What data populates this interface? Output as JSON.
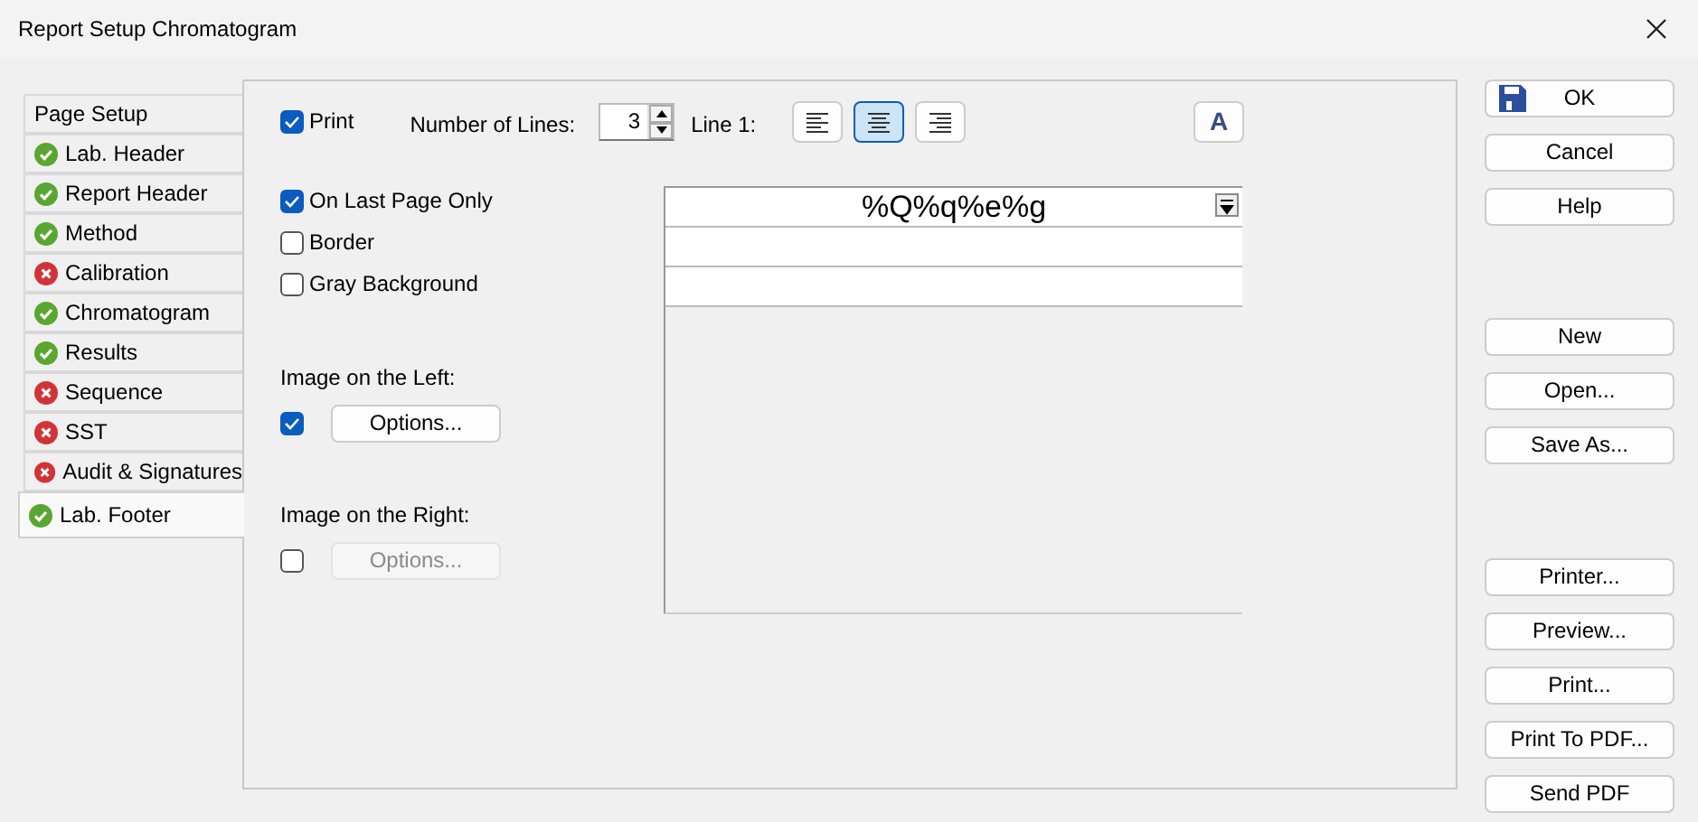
{
  "window": {
    "title": "Report Setup Chromatogram"
  },
  "tabs": [
    {
      "label": "Page Setup",
      "selected": false
    },
    {
      "label": "Lab. Header",
      "kind": "ok",
      "selected": false
    },
    {
      "label": "Report Header",
      "kind": "ok",
      "selected": false
    },
    {
      "label": "Method",
      "kind": "ok",
      "selected": false
    },
    {
      "label": "Calibration",
      "kind": "error",
      "selected": false
    },
    {
      "label": "Chromatogram",
      "kind": "ok",
      "selected": false
    },
    {
      "label": "Results",
      "kind": "ok",
      "selected": false
    },
    {
      "label": "Sequence",
      "kind": "error",
      "selected": false
    },
    {
      "label": "SST",
      "kind": "error",
      "selected": false
    },
    {
      "label": "Audit & Signatures",
      "kind": "error",
      "selected": false
    },
    {
      "label": "Lab. Footer",
      "kind": "ok",
      "selected": true
    }
  ],
  "print": {
    "label": "Print",
    "checked": true
  },
  "number_of_lines": {
    "label": "Number of Lines:",
    "value": "3"
  },
  "line_label": "Line 1:",
  "alignment_buttons": [
    {
      "kind": "left",
      "selected": false
    },
    {
      "kind": "center",
      "selected": true
    },
    {
      "kind": "right",
      "selected": false
    }
  ],
  "font_button": "A",
  "options": [
    {
      "label": "On Last Page Only",
      "checked": true
    },
    {
      "label": "Border",
      "checked": false
    },
    {
      "label": "Gray Background",
      "checked": false
    }
  ],
  "image_left": {
    "label": "Image on the Left:",
    "checked": true,
    "button": "Options...",
    "disabled": false
  },
  "image_right": {
    "label": "Image on the Right:",
    "checked": false,
    "button": "Options...",
    "disabled": true
  },
  "footer_lines": {
    "line_1": "%Q%q%e%g"
  },
  "button_groups": [
    [
      "OK",
      "Cancel",
      "Help"
    ],
    [
      "New",
      "Open...",
      "Save As..."
    ],
    [
      "Printer...",
      "Preview...",
      "Print...",
      "Print To PDF...",
      "Send PDF"
    ]
  ]
}
